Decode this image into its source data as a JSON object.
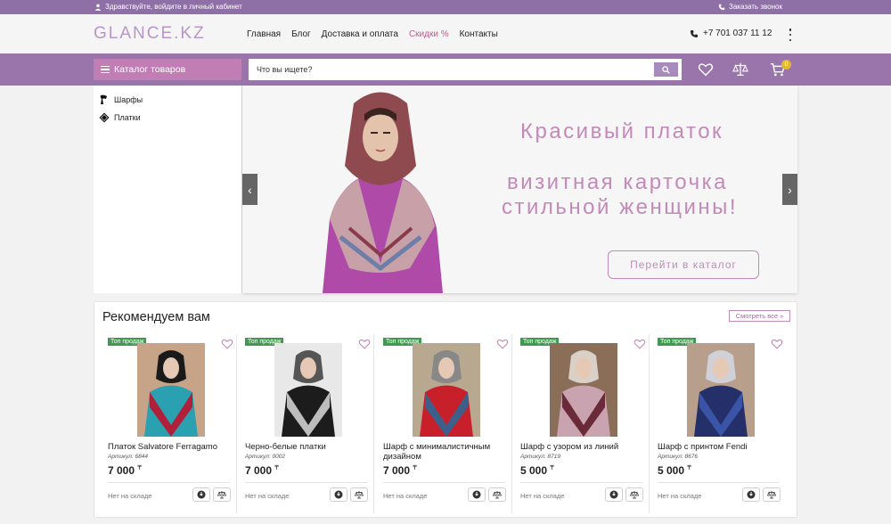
{
  "topbar": {
    "greeting": "Здравствуйте, войдите в личный кабинет",
    "callback": "Заказать звонок"
  },
  "header": {
    "logo": "GLANCE.KZ",
    "nav": [
      "Главная",
      "Блог",
      "Доставка и оплата",
      "Скидки %",
      "Контакты"
    ],
    "phone": "+7 701 037 11 12"
  },
  "search": {
    "catalog_label": "Каталог товаров",
    "placeholder": "Что вы ищете?",
    "cart_count": "0"
  },
  "categories": [
    {
      "label": "Шарфы",
      "icon": "scarf-icon"
    },
    {
      "label": "Платки",
      "icon": "shawl-icon"
    }
  ],
  "hero": {
    "line1": "Красивый платок",
    "line2": "визитная карточка",
    "line3": "стильной женщины!",
    "cta": "Перейти в каталог"
  },
  "recommended": {
    "title": "Рекомендуем вам",
    "see_all": "Смотреть все »",
    "badge": "Топ продаж",
    "stock": "Нет на складе",
    "currency": "₸",
    "products": [
      {
        "name": "Платок Salvatore Ferragamo",
        "sku": "Артикул: 6844",
        "price": "7 000"
      },
      {
        "name": "Черно-белые платки",
        "sku": "Артикул: 0002",
        "price": "7 000"
      },
      {
        "name": "Шарф с минималистичным дизайном",
        "sku": "",
        "price": "7 000"
      },
      {
        "name": "Шарф с узором из линий",
        "sku": "Артикул: 8719",
        "price": "5 000"
      },
      {
        "name": "Шарф с принтом Fendi",
        "sku": "Артикул: 8676",
        "price": "5 000"
      }
    ]
  },
  "colors": {
    "topbar": "#8e6fa6",
    "searchbar": "#9a75ab",
    "accent": "#c38ab9",
    "badge": "#3f9a50",
    "cart_badge": "#e5b82a"
  }
}
